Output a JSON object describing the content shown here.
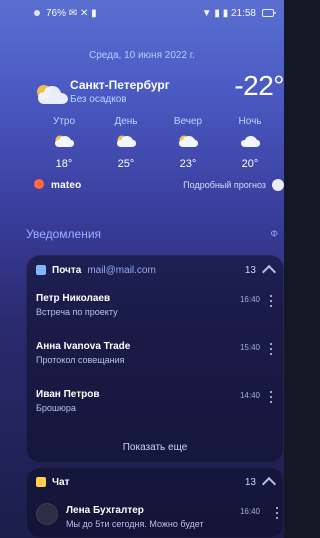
{
  "status_bar": {
    "left": "76% ✉ ✕ ▮",
    "right": "▼ ▮ ▮ 21:58"
  },
  "weather": {
    "date": "Среда, 10 июня 2022 г.",
    "city": "Санкт‑Петербург",
    "condition": "Без осадков",
    "temp_now": "-22°",
    "periods": [
      {
        "label": "Утро",
        "temp": "18°"
      },
      {
        "label": "День",
        "temp": "25°"
      },
      {
        "label": "Вечер",
        "temp": "23°"
      },
      {
        "label": "Ночь",
        "temp": "20°"
      }
    ],
    "brand": "mateo",
    "forecast_link": "Подробный прогноз"
  },
  "notifications": {
    "header": "Уведомления",
    "header_right": "Ф"
  },
  "mail_card": {
    "app": "Почта",
    "account": "mail@mail.com",
    "count": "13",
    "items": [
      {
        "name": "Петр Николаев",
        "preview": "Встреча по проекту",
        "time": "16:40"
      },
      {
        "name": "Анна Ivanova Trade",
        "preview": "Протокол совещания",
        "time": "15:40"
      },
      {
        "name": "Иван Петров",
        "preview": "Брошюра",
        "time": "14:40"
      }
    ],
    "show_more": "Показать еще"
  },
  "chat_card": {
    "app": "Чат",
    "count": "13",
    "item": {
      "name": "Лена Бухгалтер",
      "preview": "Мы до 5ти сегодня. Можно будет",
      "time": "16:40"
    }
  },
  "colors": {
    "accent": "#9bb2ff",
    "mail_icon": "#7fb5ff",
    "chat_icon": "#ffd04d",
    "brand_dot": "#ff6a3d"
  }
}
